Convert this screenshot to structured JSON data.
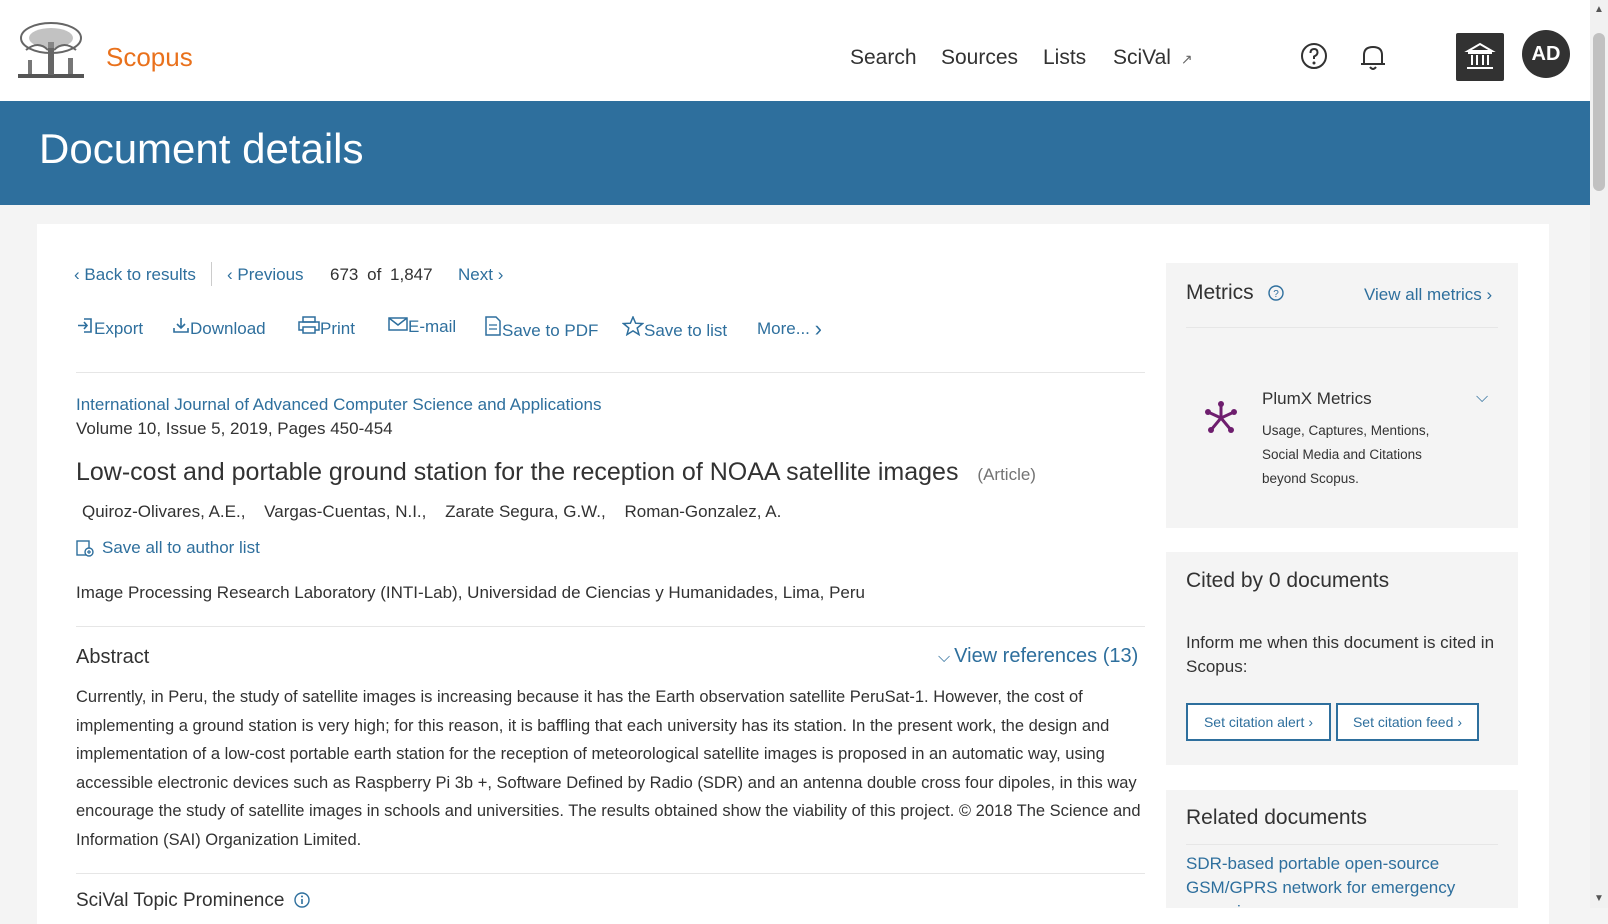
{
  "header": {
    "brand": "Scopus",
    "nav": [
      "Search",
      "Sources",
      "Lists",
      "SciVal"
    ],
    "scival_arrow": "↗",
    "avatar_initials": "AD",
    "brand_color": "#e9711c",
    "accent_color": "#2e6f9d"
  },
  "banner": {
    "title": "Document details"
  },
  "pager": {
    "back": "Back to results",
    "previous": "Previous",
    "current": "673",
    "of": "of",
    "total": "1,847",
    "next": "Next"
  },
  "toolbar": {
    "export": "Export",
    "download": "Download",
    "print": "Print",
    "email": "E-mail",
    "save_pdf": "Save to PDF",
    "save_list": "Save to list",
    "more": "More..."
  },
  "document": {
    "journal": "International Journal of Advanced Computer Science and Applications",
    "volume": "Volume 10, Issue 5, 2019, Pages 450-454",
    "title": "Low-cost and portable ground station for the reception of NOAA satellite images",
    "type": "(Article)",
    "authors": [
      "Quiroz-Olivares, A.E.,",
      "Vargas-Cuentas, N.I.,",
      "Zarate Segura, G.W.,",
      "Roman-Gonzalez, A."
    ],
    "save_authors": "Save all to author list",
    "affiliation": "Image Processing Research Laboratory (INTI-Lab), Universidad de Ciencias y Humanidades, Lima, Peru"
  },
  "abstract": {
    "heading": "Abstract",
    "view_refs": "View references (13)",
    "text": "Currently, in Peru, the study of satellite images is increasing because it has the Earth observation satellite PeruSat-1. However, the cost of implementing a ground station is very high; for this reason, it is baffling that each university has its station. In the present work, the design and implementation of a low-cost portable earth station for the reception of meteorological satellite images is proposed in an automatic way, using accessible electronic devices such as Raspberry Pi 3b +, Software Defined by Radio (SDR) and an antenna double cross four dipoles, in this way encourage the study of satellite images in schools and universities. The results obtained show the viability of this project. © 2018 The Science and Information (SAI) Organization Limited."
  },
  "scival": {
    "heading": "SciVal Topic Prominence"
  },
  "metrics": {
    "heading": "Metrics",
    "view_all": "View all metrics",
    "plumx_title": "PlumX Metrics",
    "plumx_desc": [
      "Usage, Captures, Mentions,",
      "Social Media and Citations",
      "beyond Scopus."
    ],
    "plumx_color": "#6e1e6e"
  },
  "cited": {
    "heading": "Cited by 0 documents",
    "text": "Inform me when this document is cited in Scopus:",
    "alert_btn": "Set citation alert",
    "feed_btn": "Set citation feed"
  },
  "related": {
    "heading": "Related documents",
    "first_link": "SDR-based portable open-source GSM/GPRS network for emergency scenarios"
  }
}
